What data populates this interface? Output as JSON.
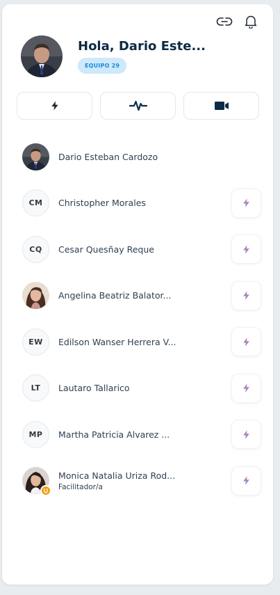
{
  "header": {
    "greeting": "Hola, Dario Este...",
    "team_badge": "EQUIPO 29"
  },
  "top_icons": [
    "link-icon",
    "bell-icon"
  ],
  "actions": [
    "bolt-icon",
    "activity-icon",
    "video-icon"
  ],
  "members": [
    {
      "name": "Dario Esteban Cardozo",
      "avatar": "photo",
      "has_bolt": false
    },
    {
      "name": "Christopher Morales",
      "initials": "CM",
      "has_bolt": true
    },
    {
      "name": "Cesar Quesñay Reque",
      "initials": "CQ",
      "has_bolt": true
    },
    {
      "name": "Angelina Beatriz Balator...",
      "avatar": "photo",
      "has_bolt": true
    },
    {
      "name": "Edilson Wanser Herrera V...",
      "initials": "EW",
      "has_bolt": true
    },
    {
      "name": "Lautaro Tallarico",
      "initials": "LT",
      "has_bolt": true
    },
    {
      "name": "Martha Patricia Alvarez ...",
      "initials": "MP",
      "has_bolt": true
    },
    {
      "name": "Monica Natalia Uriza Rod...",
      "avatar": "photo",
      "role": "Facilitador/a",
      "has_bolt": true
    }
  ],
  "colors": {
    "title": "#0d2b45",
    "badge_bg": "#cde9fb",
    "badge_text": "#1e8ad6",
    "bolt_gradient_start": "#f07aa0",
    "bolt_gradient_end": "#5b8de0",
    "facilitator_badge": "#f39c12"
  }
}
